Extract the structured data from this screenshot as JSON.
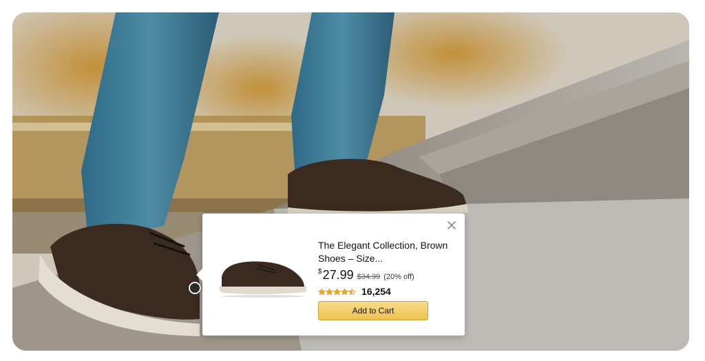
{
  "scene": {
    "description_image": "lifestyle-photo-walking-up-stairs",
    "hotspot_icon": "product-hotspot-dot"
  },
  "popover": {
    "close_icon": "close-icon",
    "product_image_icon": "brown-shoe-thumbnail",
    "title": "The Elegant Collection, Brown Shoes – Size...",
    "price_currency": "$",
    "price_amount": "27.99",
    "old_price": "$34.99",
    "discount": "(20% off)",
    "rating_value": 4.5,
    "rating_max": 5,
    "review_count": "16,254",
    "add_to_cart_label": "Add to Cart",
    "colors": {
      "button_top": "#f7dc8c",
      "button_bottom": "#f0c14b",
      "star": "#f4a41c"
    }
  }
}
